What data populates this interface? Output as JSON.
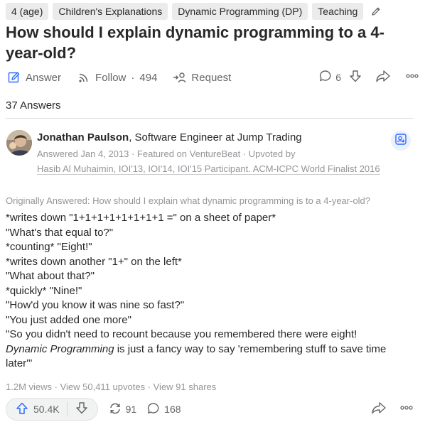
{
  "topics": [
    "4 (age)",
    "Children's Explanations",
    "Dynamic Programming (DP)",
    "Teaching"
  ],
  "question": {
    "title": "How should I explain dynamic programming to a 4-year-old?"
  },
  "question_actions": {
    "answer_label": "Answer",
    "follow_label": "Follow",
    "follow_count": "494",
    "request_label": "Request",
    "comment_count": "6"
  },
  "answers_count": "37 Answers",
  "answer": {
    "author_name": "Jonathan Paulson",
    "author_credential": ", Software Engineer at Jump Trading",
    "meta": "Answered Jan 4, 2013 · Featured on VentureBeat · Upvoted by",
    "upvoted_by": "Hasib Al Muhaimin, IOI'13, IOI'14, IOI'15 Participant. ACM-ICPC World Finalist 2016",
    "originally_answered": "Originally Answered: How should I explain what dynamic programming is to a 4-year-old?",
    "lines": [
      "*writes down \"1+1+1+1+1+1+1+1 =\" on a sheet of paper*",
      "\"What's that equal to?\"",
      "*counting* \"Eight!\"",
      "*writes down another \"1+\" on the left*",
      "\"What about that?\"",
      "*quickly* \"Nine!\"",
      "\"How'd you know it was nine so fast?\"",
      "\"You just added one more\"",
      "\"So you didn't need to recount because you remembered there were eight!"
    ],
    "last_line_em": "Dynamic Programming",
    "last_line_rest": " is just a fancy way to say 'remembering stuff to save time later'\"",
    "stats": "1.2M views · View 50,411 upvotes · View 91 shares",
    "upvotes": "50.4K",
    "shares": "91",
    "comments": "168"
  },
  "colors": {
    "accent_blue": "#2e69ff",
    "text": "#282829",
    "muted": "#939598",
    "icon": "#636466"
  }
}
